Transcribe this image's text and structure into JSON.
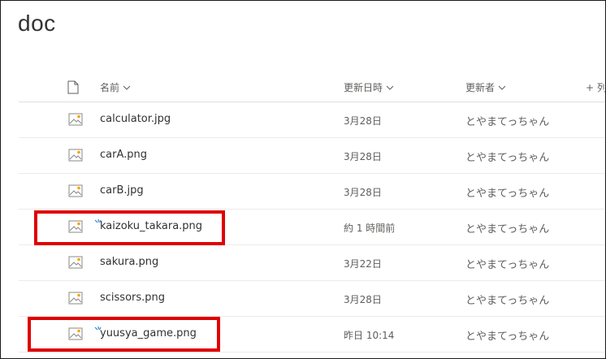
{
  "library": {
    "title": "doc"
  },
  "columns": {
    "name": "名前",
    "modified": "更新日時",
    "modified_by": "更新者",
    "add_column": "+ 列"
  },
  "files": [
    {
      "name": "calculator.jpg",
      "modified": "3月28日",
      "modified_by": "とやまてっちゃん",
      "is_new": false
    },
    {
      "name": "carA.png",
      "modified": "3月28日",
      "modified_by": "とやまてっちゃん",
      "is_new": false
    },
    {
      "name": "carB.jpg",
      "modified": "3月28日",
      "modified_by": "とやまてっちゃん",
      "is_new": false
    },
    {
      "name": "kaizoku_takara.png",
      "modified": "約 1 時間前",
      "modified_by": "とやまてっちゃん",
      "is_new": true
    },
    {
      "name": "sakura.png",
      "modified": "3月22日",
      "modified_by": "とやまてっちゃん",
      "is_new": false
    },
    {
      "name": "scissors.png",
      "modified": "3月28日",
      "modified_by": "とやまてっちゃん",
      "is_new": false
    },
    {
      "name": "yuusya_game.png",
      "modified": "昨日 10:14",
      "modified_by": "とやまてっちゃん",
      "is_new": true
    }
  ],
  "icons": {
    "file_type": "image-file-icon",
    "new_indicator": "new-item-sparkle-icon",
    "header": "document-icon"
  },
  "colors": {
    "highlight": "#e00000",
    "new_indicator": "#2b88d8",
    "image_icon_accent": "#f7a30b"
  }
}
